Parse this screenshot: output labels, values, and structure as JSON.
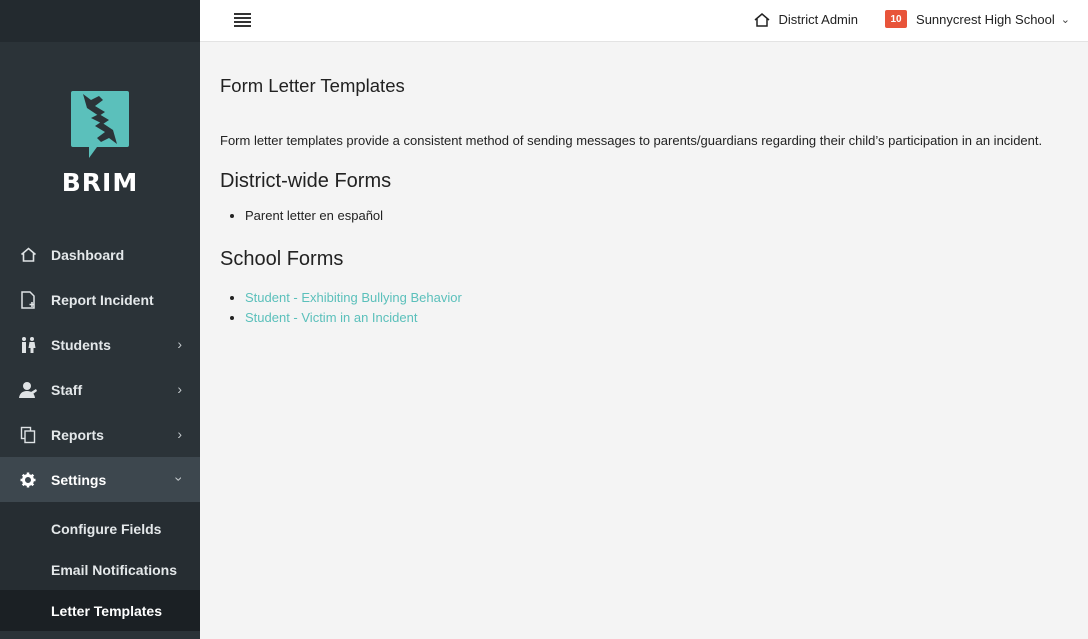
{
  "header": {
    "district_label": "District Admin",
    "school_badge": "10",
    "school_name": "Sunnycrest High School"
  },
  "brand": {
    "name": "BRIM",
    "accent": "#5bc0bb"
  },
  "sidebar": {
    "items": [
      {
        "label": "Dashboard",
        "icon": "home-icon"
      },
      {
        "label": "Report Incident",
        "icon": "file-plus-icon"
      },
      {
        "label": "Students",
        "icon": "students-icon"
      },
      {
        "label": "Staff",
        "icon": "staff-icon"
      },
      {
        "label": "Reports",
        "icon": "copy-icon"
      },
      {
        "label": "Settings",
        "icon": "gear-icon"
      }
    ],
    "settings_sub": [
      {
        "label": "Configure Fields"
      },
      {
        "label": "Email Notifications"
      },
      {
        "label": "Letter Templates"
      }
    ]
  },
  "main": {
    "title": "Form Letter Templates",
    "intro": "Form letter templates provide a consistent method of sending messages to parents/guardians regarding their child’s participation in an incident.",
    "district_forms": {
      "title": "District-wide Forms",
      "items": [
        "Parent letter en español"
      ]
    },
    "school_forms": {
      "title": "School Forms",
      "items": [
        "Student - Exhibiting Bullying Behavior",
        "Student - Victim in an Incident"
      ]
    }
  }
}
